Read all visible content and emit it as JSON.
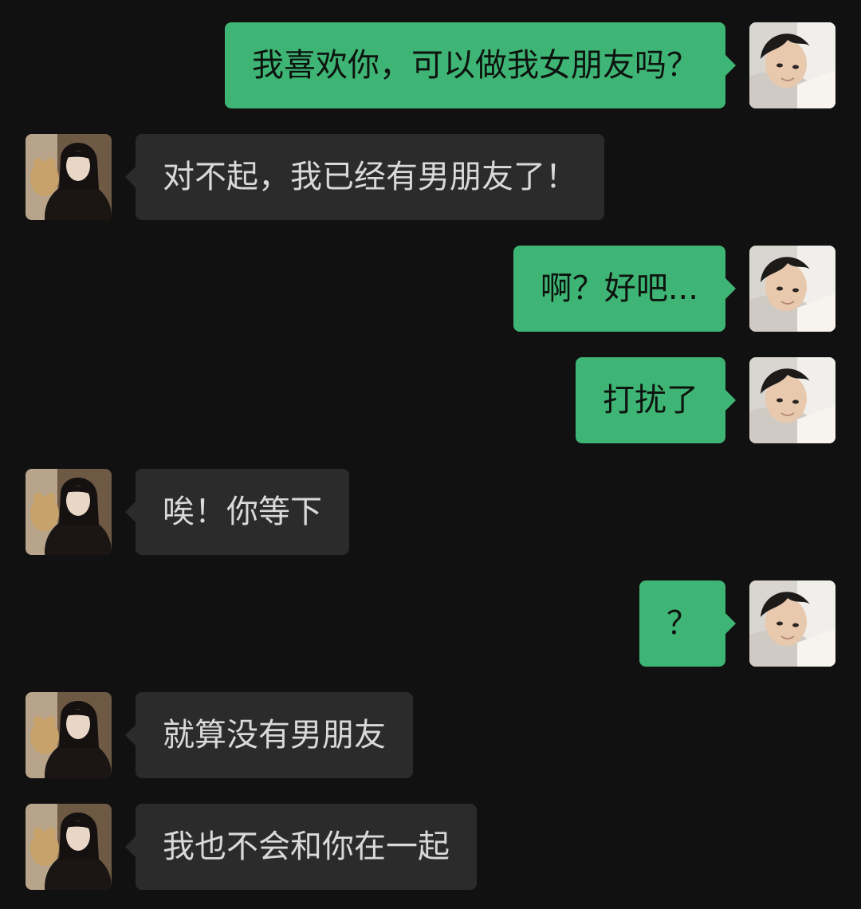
{
  "messages": [
    {
      "from": "me",
      "text": "我喜欢你，可以做我女朋友吗？"
    },
    {
      "from": "other",
      "text": "对不起，我已经有男朋友了！"
    },
    {
      "from": "me",
      "text": "啊？好吧..."
    },
    {
      "from": "me",
      "text": "打扰了"
    },
    {
      "from": "other",
      "text": "唉！你等下"
    },
    {
      "from": "me",
      "text": "？"
    },
    {
      "from": "other",
      "text": "就算没有男朋友"
    },
    {
      "from": "other",
      "text": "我也不会和你在一起"
    }
  ],
  "avatars": {
    "me": "boy-avatar",
    "other": "girl-with-teddy-bear-avatar"
  },
  "colors": {
    "background": "#111111",
    "outgoing_bubble": "#3eb574",
    "incoming_bubble": "#2b2b2b"
  }
}
